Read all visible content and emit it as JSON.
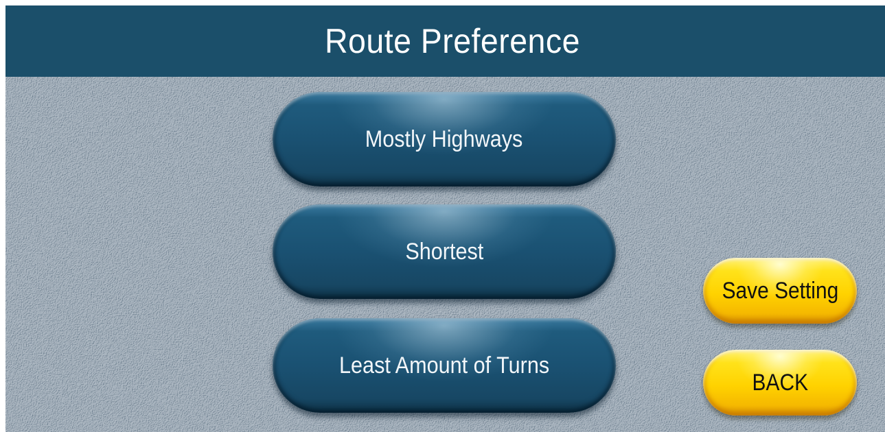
{
  "header": {
    "title": "Route Preference"
  },
  "options": [
    {
      "label": "Mostly Highways"
    },
    {
      "label": "Shortest"
    },
    {
      "label": "Least Amount of Turns"
    }
  ],
  "actions": {
    "save_label": "Save Setting",
    "back_label": "BACK"
  },
  "colors": {
    "title_bar": "#1b4f6a",
    "background": "#8196a8",
    "option_button": "#1a5172",
    "action_button": "#ffd200"
  }
}
